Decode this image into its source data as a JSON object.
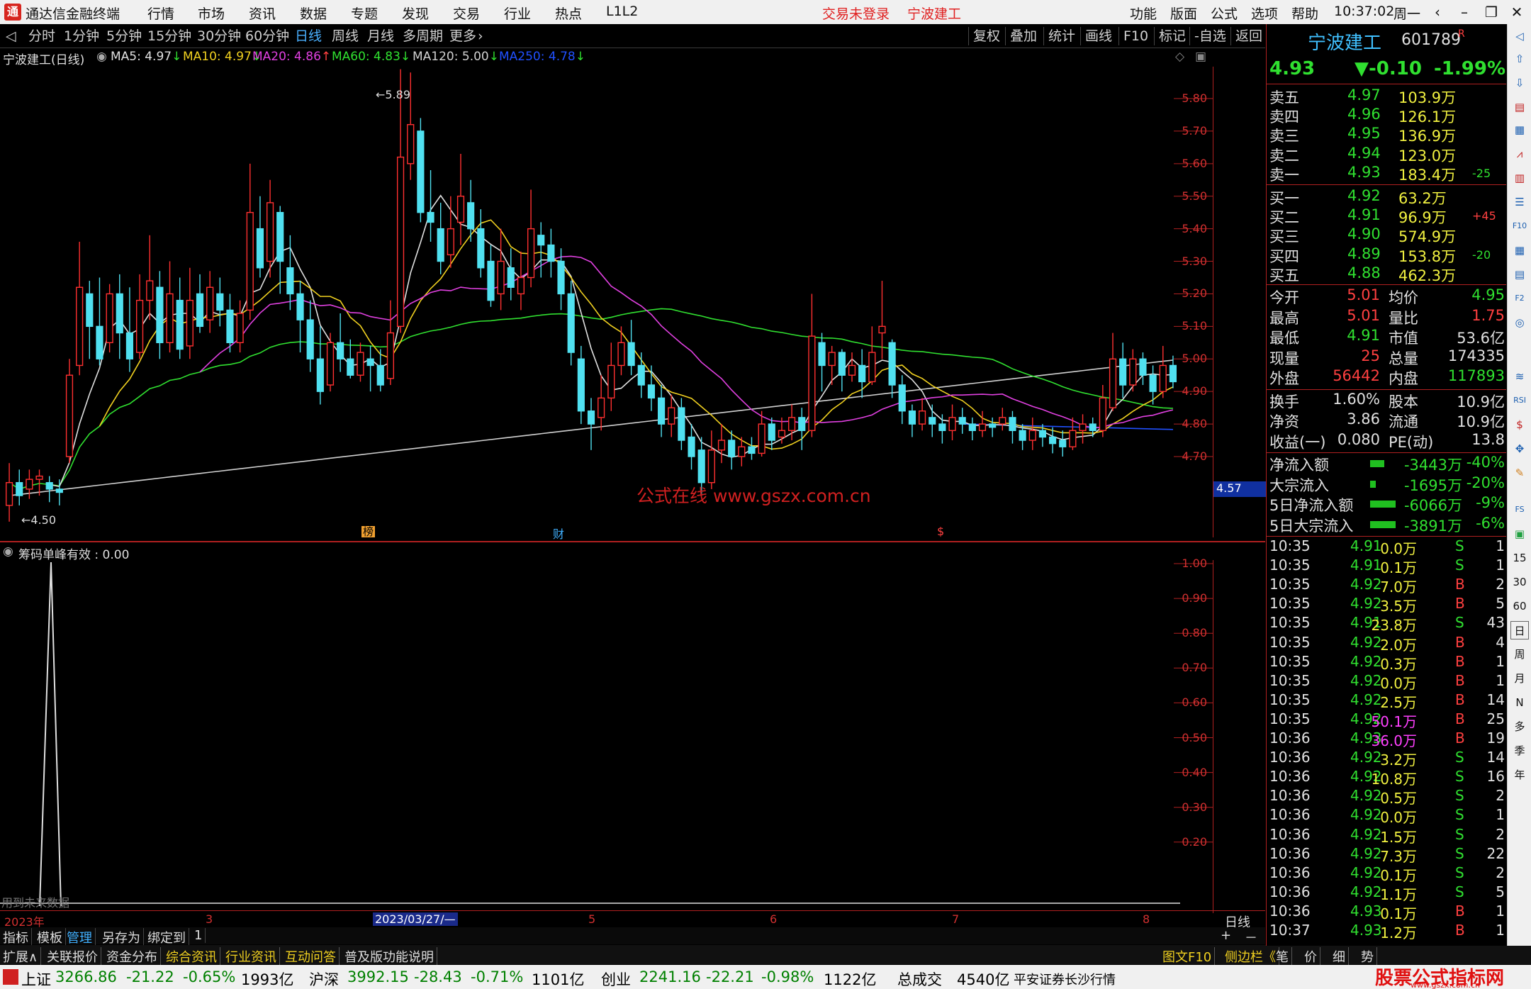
{
  "titlebar": {
    "app_title": "通达信金融终端",
    "menus": [
      "行情",
      "市场",
      "资讯",
      "数据",
      "专题",
      "发现",
      "交易",
      "行业",
      "热点",
      "L1L2"
    ],
    "login_status": "交易未登录",
    "stock_name": "宁波建工",
    "right_menus": [
      "功能",
      "版面",
      "公式",
      "选项",
      "帮助"
    ],
    "time": "10:37:02",
    "weekday": "周一"
  },
  "toolbar": {
    "periods": [
      "分时",
      "1分钟",
      "5分钟",
      "15分钟",
      "30分钟",
      "60分钟",
      "日线",
      "周线",
      "月线",
      "多周期",
      "更多"
    ],
    "active_period": "日线",
    "right_buttons": [
      "复权",
      "叠加",
      "统计",
      "画线",
      "F10",
      "标记",
      "-自选",
      "返回"
    ]
  },
  "ma_header": {
    "title": "宁波建工(日线)",
    "items": [
      {
        "label": "MA5: 4.97",
        "arrow": "↓",
        "color": "#e0e0e0"
      },
      {
        "label": "MA10: 4.97",
        "arrow": "↓",
        "color": "#f0d020"
      },
      {
        "label": "MA20: 4.86",
        "arrow": "↑",
        "color": "#e040e0"
      },
      {
        "label": "MA60: 4.83",
        "arrow": "↓",
        "color": "#30e030"
      },
      {
        "label": "MA120: 5.00",
        "arrow": "↓",
        "color": "#d0d0d0"
      },
      {
        "label": "MA250: 4.78",
        "arrow": "↓",
        "color": "#2050ff"
      }
    ]
  },
  "main_chart": {
    "y_ticks": [
      "5.80",
      "5.70",
      "5.60",
      "5.50",
      "5.40",
      "5.30",
      "5.20",
      "5.10",
      "5.00",
      "4.90",
      "4.80",
      "4.70"
    ],
    "high_label": "5.89",
    "low_label": "4.50",
    "current_price_tag": "4.57",
    "watermark": "公式在线 www.gszx.com.cn",
    "markers": [
      "榜",
      "财",
      "$"
    ]
  },
  "indicator": {
    "title": "筹码单峰有效 : 0.00",
    "y_ticks": [
      "1.00",
      "0.90",
      "0.80",
      "0.70",
      "0.60",
      "0.50",
      "0.40",
      "0.30",
      "0.20"
    ],
    "note": "用到未来数据"
  },
  "x_axis": {
    "labels": [
      "2023年",
      "3",
      "2023/03/27/—",
      "5",
      "6",
      "7",
      "8"
    ],
    "period_label": "日线"
  },
  "bottom_tabs": [
    "指标",
    "模板",
    "管理",
    "另存为",
    "绑定到",
    "1"
  ],
  "zoom": [
    "+",
    "－"
  ],
  "func_tabs": [
    "扩展∧",
    "关联报价",
    "资金分布",
    "综合资讯",
    "行业资讯",
    "互动问答",
    "普及版功能说明"
  ],
  "func_right": [
    "图文F10",
    "侧边栏《",
    "笔",
    "价",
    "细",
    "势"
  ],
  "quote": {
    "name": "宁波建工",
    "code": "601789",
    "flag": "R",
    "price": "4.93",
    "change": "▼-0.10",
    "pct": "-1.99%",
    "asks": [
      {
        "label": "卖五",
        "price": "4.97",
        "vol": "103.9万",
        "chg": ""
      },
      {
        "label": "卖四",
        "price": "4.96",
        "vol": "126.1万",
        "chg": ""
      },
      {
        "label": "卖三",
        "price": "4.95",
        "vol": "136.9万",
        "chg": ""
      },
      {
        "label": "卖二",
        "price": "4.94",
        "vol": "123.0万",
        "chg": ""
      },
      {
        "label": "卖一",
        "price": "4.93",
        "vol": "183.4万",
        "chg": "-25"
      }
    ],
    "bids": [
      {
        "label": "买一",
        "price": "4.92",
        "vol": "63.2万",
        "chg": ""
      },
      {
        "label": "买二",
        "price": "4.91",
        "vol": "96.9万",
        "chg": "+45"
      },
      {
        "label": "买三",
        "price": "4.90",
        "vol": "574.9万",
        "chg": ""
      },
      {
        "label": "买四",
        "price": "4.89",
        "vol": "153.8万",
        "chg": "-20"
      },
      {
        "label": "买五",
        "price": "4.88",
        "vol": "462.3万",
        "chg": ""
      }
    ],
    "stats": [
      {
        "l1": "今开",
        "v1": "5.01",
        "l2": "均价",
        "v2": "4.95"
      },
      {
        "l1": "最高",
        "v1": "5.01",
        "l2": "量比",
        "v2": "1.75"
      },
      {
        "l1": "最低",
        "v1": "4.91",
        "l2": "市值",
        "v2": "53.6亿"
      },
      {
        "l1": "现量",
        "v1": "25",
        "l2": "总量",
        "v2": "174335"
      },
      {
        "l1": "外盘",
        "v1": "56442",
        "l2": "内盘",
        "v2": "117893"
      }
    ],
    "stats2": [
      {
        "l1": "换手",
        "v1": "1.60%",
        "l2": "股本",
        "v2": "10.9亿"
      },
      {
        "l1": "净资",
        "v1": "3.86",
        "l2": "流通",
        "v2": "10.9亿"
      },
      {
        "l1": "收益(一)",
        "v1": "0.080",
        "l2": "PE(动)",
        "v2": "13.8"
      }
    ],
    "flows": [
      {
        "label": "净流入额",
        "value": "-3443万",
        "pct": "-40%"
      },
      {
        "label": "大宗流入",
        "value": "-1695万",
        "pct": "-20%"
      },
      {
        "label": "5日净流入额",
        "value": "-6066万",
        "pct": "-9%"
      },
      {
        "label": "5日大宗流入",
        "value": "-3891万",
        "pct": "-6%"
      }
    ],
    "ticks": [
      {
        "t": "10:35",
        "p": "4.91",
        "v": "0.0万",
        "s": "S",
        "n": "1"
      },
      {
        "t": "10:35",
        "p": "4.91",
        "v": "0.1万",
        "s": "S",
        "n": "1"
      },
      {
        "t": "10:35",
        "p": "4.92",
        "v": "7.0万",
        "s": "B",
        "n": "2"
      },
      {
        "t": "10:35",
        "p": "4.92",
        "v": "3.5万",
        "s": "B",
        "n": "5"
      },
      {
        "t": "10:35",
        "p": "4.91",
        "v": "23.8万",
        "s": "S",
        "n": "43"
      },
      {
        "t": "10:35",
        "p": "4.92",
        "v": "2.0万",
        "s": "B",
        "n": "4"
      },
      {
        "t": "10:35",
        "p": "4.92",
        "v": "0.3万",
        "s": "B",
        "n": "1"
      },
      {
        "t": "10:35",
        "p": "4.92",
        "v": "0.0万",
        "s": "B",
        "n": "1"
      },
      {
        "t": "10:35",
        "p": "4.92",
        "v": "2.5万",
        "s": "B",
        "n": "14"
      },
      {
        "t": "10:35",
        "p": "4.92",
        "v": "50.1万",
        "s": "B",
        "n": "25"
      },
      {
        "t": "10:36",
        "p": "4.93",
        "v": "36.0万",
        "s": "B",
        "n": "19"
      },
      {
        "t": "10:36",
        "p": "4.92",
        "v": "3.2万",
        "s": "S",
        "n": "14"
      },
      {
        "t": "10:36",
        "p": "4.92",
        "v": "10.8万",
        "s": "S",
        "n": "16"
      },
      {
        "t": "10:36",
        "p": "4.92",
        "v": "0.5万",
        "s": "S",
        "n": "2"
      },
      {
        "t": "10:36",
        "p": "4.92",
        "v": "0.0万",
        "s": "S",
        "n": "1"
      },
      {
        "t": "10:36",
        "p": "4.92",
        "v": "1.5万",
        "s": "S",
        "n": "2"
      },
      {
        "t": "10:36",
        "p": "4.92",
        "v": "7.3万",
        "s": "S",
        "n": "22"
      },
      {
        "t": "10:36",
        "p": "4.92",
        "v": "0.1万",
        "s": "S",
        "n": "2"
      },
      {
        "t": "10:36",
        "p": "4.92",
        "v": "1.1万",
        "s": "S",
        "n": "5"
      },
      {
        "t": "10:36",
        "p": "4.93",
        "v": "0.1万",
        "s": "B",
        "n": "1"
      },
      {
        "t": "10:37",
        "p": "4.93",
        "v": "1.2万",
        "s": "B",
        "n": "1"
      }
    ]
  },
  "sidebar": [
    "15",
    "30",
    "60",
    "日",
    "周",
    "月",
    "N",
    "多",
    "季",
    "年"
  ],
  "statusbar": {
    "items": [
      {
        "name": "上证",
        "val": "3266.86",
        "chg": "-21.22",
        "pct": "-0.65%",
        "amt": "1993亿"
      },
      {
        "name": "沪深",
        "val": "3992.15",
        "chg": "-28.43",
        "pct": "-0.71%",
        "amt": "1101亿"
      },
      {
        "name": "创业",
        "val": "2241.16",
        "chg": "-22.21",
        "pct": "-0.98%",
        "amt": "1122亿"
      }
    ],
    "total_label": "总成交",
    "total_val": "4540亿",
    "broker": "平安证券长沙行情",
    "brand": "股票公式指标网",
    "brand_url": "www.gszx.com.cn"
  },
  "chart_data": {
    "type": "candlestick",
    "ylim": [
      4.5,
      5.89
    ],
    "candles": [
      [
        4.55,
        4.62,
        4.68,
        4.5
      ],
      [
        4.62,
        4.58,
        4.66,
        4.55
      ],
      [
        4.6,
        4.63,
        4.66,
        4.57
      ],
      [
        4.63,
        4.64,
        4.66,
        4.58
      ],
      [
        4.62,
        4.6,
        4.64,
        4.56
      ],
      [
        4.6,
        4.59,
        4.63,
        4.55
      ],
      [
        4.7,
        4.95,
        5.0,
        4.68
      ],
      [
        4.98,
        5.22,
        5.36,
        4.95
      ],
      [
        5.2,
        5.1,
        5.24,
        5.0
      ],
      [
        5.1,
        5.0,
        5.25,
        4.98
      ],
      [
        5.05,
        5.2,
        5.23,
        5.02
      ],
      [
        5.2,
        5.08,
        5.26,
        5.0
      ],
      [
        5.08,
        5.0,
        5.22,
        4.96
      ],
      [
        5.02,
        5.18,
        5.26,
        5.0
      ],
      [
        5.18,
        5.24,
        5.38,
        5.12
      ],
      [
        5.22,
        5.05,
        5.27,
        5.0
      ],
      [
        5.05,
        5.2,
        5.3,
        5.02
      ],
      [
        5.18,
        5.03,
        5.25,
        5.0
      ],
      [
        5.04,
        5.18,
        5.28,
        5.0
      ],
      [
        5.2,
        5.1,
        5.26,
        5.08
      ],
      [
        5.12,
        5.22,
        5.27,
        5.08
      ],
      [
        5.2,
        5.15,
        5.25,
        5.1
      ],
      [
        5.15,
        5.05,
        5.2,
        5.02
      ],
      [
        5.05,
        5.14,
        5.18,
        5.02
      ],
      [
        5.15,
        5.45,
        5.6,
        5.12
      ],
      [
        5.4,
        5.28,
        5.5,
        5.25
      ],
      [
        5.3,
        5.48,
        5.55,
        5.25
      ],
      [
        5.45,
        5.3,
        5.47,
        5.2
      ],
      [
        5.28,
        5.2,
        5.38,
        5.15
      ],
      [
        5.2,
        5.12,
        5.24,
        5.02
      ],
      [
        5.12,
        5.0,
        5.18,
        4.96
      ],
      [
        5.0,
        4.9,
        5.1,
        4.86
      ],
      [
        4.92,
        5.05,
        5.08,
        4.9
      ],
      [
        5.05,
        5.0,
        5.14,
        4.96
      ],
      [
        5.0,
        4.95,
        5.06,
        4.94
      ],
      [
        4.95,
        5.02,
        5.05,
        4.93
      ],
      [
        5.0,
        4.98,
        5.04,
        4.9
      ],
      [
        4.98,
        4.92,
        5.03,
        4.9
      ],
      [
        4.94,
        5.08,
        5.18,
        4.92
      ],
      [
        5.1,
        5.62,
        5.89,
        5.08
      ],
      [
        5.6,
        5.72,
        5.88,
        5.55
      ],
      [
        5.7,
        5.45,
        5.74,
        5.42
      ],
      [
        5.45,
        5.42,
        5.58,
        5.36
      ],
      [
        5.4,
        5.3,
        5.48,
        5.26
      ],
      [
        5.32,
        5.4,
        5.5,
        5.28
      ],
      [
        5.42,
        5.5,
        5.63,
        5.35
      ],
      [
        5.48,
        5.4,
        5.55,
        5.36
      ],
      [
        5.4,
        5.28,
        5.46,
        5.25
      ],
      [
        5.3,
        5.18,
        5.35,
        5.16
      ],
      [
        5.2,
        5.3,
        5.4,
        5.15
      ],
      [
        5.28,
        5.22,
        5.34,
        5.18
      ],
      [
        5.2,
        5.25,
        5.33,
        5.15
      ],
      [
        5.25,
        5.4,
        5.52,
        5.22
      ],
      [
        5.38,
        5.35,
        5.42,
        5.25
      ],
      [
        5.35,
        5.3,
        5.4,
        5.25
      ],
      [
        5.3,
        5.2,
        5.34,
        5.15
      ],
      [
        5.2,
        5.02,
        5.24,
        4.98
      ],
      [
        5.0,
        4.84,
        5.04,
        4.8
      ],
      [
        4.84,
        4.8,
        4.88,
        4.72
      ],
      [
        4.82,
        4.88,
        4.95,
        4.78
      ],
      [
        4.88,
        4.98,
        5.05,
        4.84
      ],
      [
        4.98,
        5.05,
        5.1,
        4.95
      ],
      [
        5.05,
        4.98,
        5.12,
        4.95
      ],
      [
        4.98,
        4.92,
        5.02,
        4.88
      ],
      [
        4.92,
        4.88,
        4.98,
        4.84
      ],
      [
        4.88,
        4.8,
        4.92,
        4.76
      ],
      [
        4.8,
        4.85,
        4.89,
        4.76
      ],
      [
        4.85,
        4.75,
        4.88,
        4.72
      ],
      [
        4.76,
        4.7,
        4.8,
        4.66
      ],
      [
        4.72,
        4.62,
        4.76,
        4.58
      ],
      [
        4.62,
        4.72,
        4.78,
        4.6
      ],
      [
        4.72,
        4.75,
        4.8,
        4.68
      ],
      [
        4.75,
        4.7,
        4.78,
        4.66
      ],
      [
        4.7,
        4.73,
        4.76,
        4.67
      ],
      [
        4.73,
        4.71,
        4.76,
        4.69
      ],
      [
        4.71,
        4.8,
        4.84,
        4.7
      ],
      [
        4.8,
        4.75,
        4.82,
        4.72
      ],
      [
        4.76,
        4.78,
        4.82,
        4.74
      ],
      [
        4.78,
        4.82,
        4.86,
        4.75
      ],
      [
        4.82,
        4.78,
        4.85,
        4.72
      ],
      [
        4.78,
        5.07,
        5.2,
        4.76
      ],
      [
        5.05,
        4.98,
        5.08,
        4.9
      ],
      [
        4.98,
        5.02,
        5.04,
        4.92
      ],
      [
        5.02,
        4.95,
        5.03,
        4.9
      ],
      [
        4.95,
        4.98,
        5.02,
        4.93
      ],
      [
        4.98,
        4.93,
        5.03,
        4.88
      ],
      [
        4.93,
        5.02,
        5.1,
        4.92
      ],
      [
        5.08,
        5.1,
        5.24,
        5.0
      ],
      [
        5.05,
        4.92,
        5.06,
        4.88
      ],
      [
        4.92,
        4.84,
        4.95,
        4.8
      ],
      [
        4.84,
        4.8,
        4.86,
        4.76
      ],
      [
        4.8,
        4.84,
        4.88,
        4.78
      ],
      [
        4.82,
        4.8,
        4.86,
        4.76
      ],
      [
        4.8,
        4.78,
        4.83,
        4.74
      ],
      [
        4.78,
        4.82,
        4.86,
        4.75
      ],
      [
        4.82,
        4.8,
        4.85,
        4.77
      ],
      [
        4.8,
        4.78,
        4.82,
        4.75
      ],
      [
        4.78,
        4.8,
        4.84,
        4.76
      ],
      [
        4.8,
        4.79,
        4.82,
        4.76
      ],
      [
        4.8,
        4.82,
        4.85,
        4.78
      ],
      [
        4.82,
        4.78,
        4.84,
        4.74
      ],
      [
        4.78,
        4.75,
        4.8,
        4.72
      ],
      [
        4.75,
        4.78,
        4.82,
        4.72
      ],
      [
        4.78,
        4.76,
        4.8,
        4.73
      ],
      [
        4.76,
        4.74,
        4.79,
        4.71
      ],
      [
        4.75,
        4.73,
        4.78,
        4.7
      ],
      [
        4.73,
        4.78,
        4.82,
        4.72
      ],
      [
        4.78,
        4.8,
        4.83,
        4.74
      ],
      [
        4.8,
        4.78,
        4.82,
        4.76
      ],
      [
        4.78,
        4.88,
        4.92,
        4.76
      ],
      [
        4.85,
        5.0,
        5.08,
        4.84
      ],
      [
        5.0,
        4.92,
        5.05,
        4.88
      ],
      [
        4.92,
        5.0,
        5.03,
        4.9
      ],
      [
        5.0,
        4.95,
        5.02,
        4.92
      ],
      [
        4.95,
        4.9,
        4.98,
        4.86
      ],
      [
        4.9,
        4.98,
        5.04,
        4.88
      ],
      [
        4.98,
        4.93,
        5.01,
        4.91
      ]
    ]
  }
}
